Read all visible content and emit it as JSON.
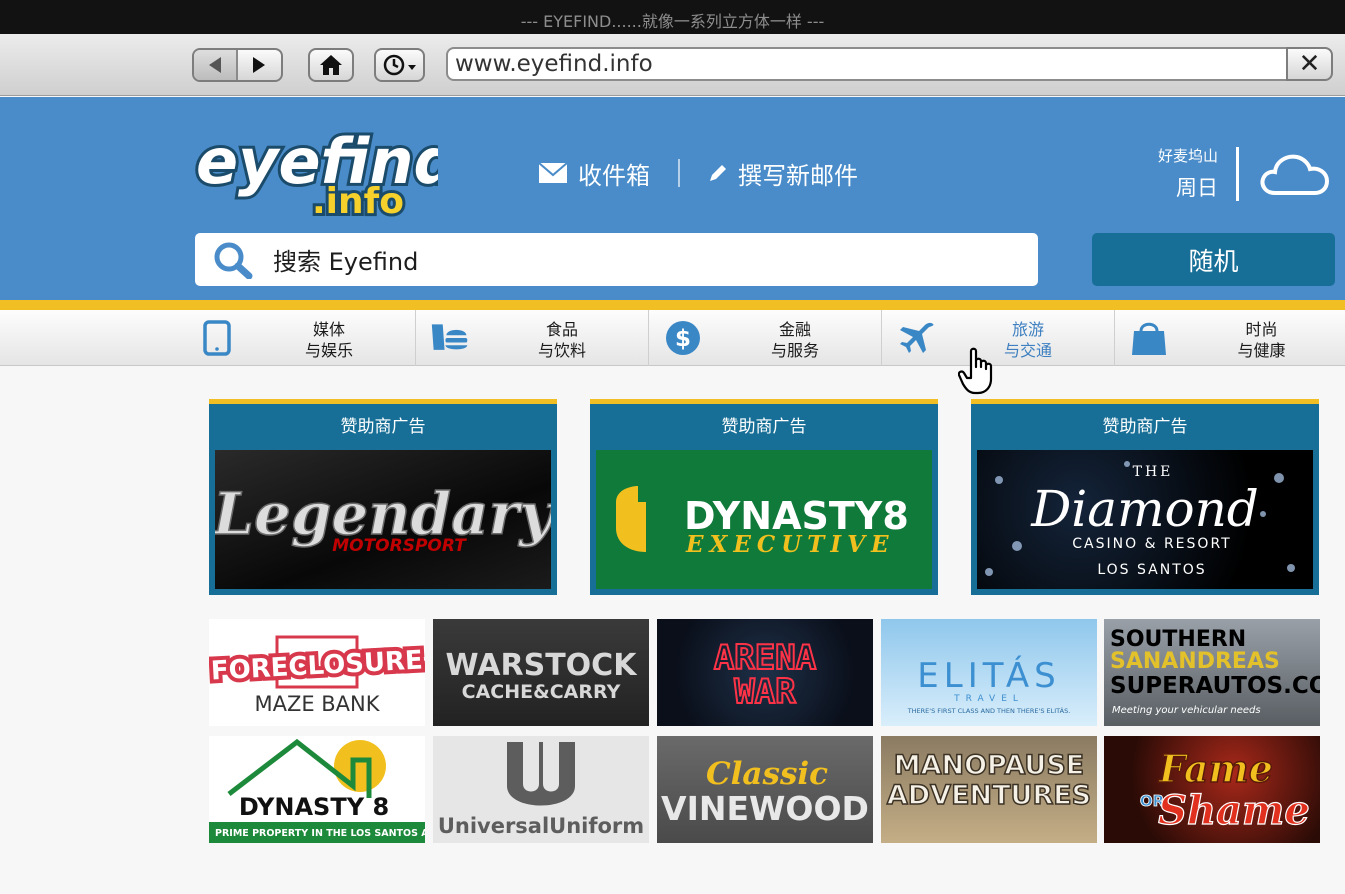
{
  "window": {
    "title": "--- EYEFIND......就像一系列立方体一样 ---"
  },
  "browser": {
    "url": "www.eyefind.info"
  },
  "header": {
    "logo_top": "eyefind",
    "logo_bottom": ".info",
    "inbox_label": "收件箱",
    "compose_label": "撰写新邮件",
    "weather_location": "好麦坞山",
    "weather_day": "周日",
    "search_label": "搜索 Eyefind",
    "random_label": "随机"
  },
  "categories": [
    {
      "line1": "媒体",
      "line2": "与娱乐",
      "icon": "tablet-icon"
    },
    {
      "line1": "食品",
      "line2": "与饮料",
      "icon": "food-icon"
    },
    {
      "line1": "金融",
      "line2": "与服务",
      "icon": "dollar-icon"
    },
    {
      "line1": "旅游",
      "line2": "与交通",
      "icon": "airplane-icon"
    },
    {
      "line1": "时尚",
      "line2": "与健康",
      "icon": "shopping-bag-icon"
    }
  ],
  "sponsors": [
    {
      "title": "赞助商广告",
      "main": "Legendary",
      "sub": "MOTORSPORT"
    },
    {
      "title": "赞助商广告",
      "main": "DYNASTY8",
      "sub": "EXECUTIVE"
    },
    {
      "title": "赞助商广告",
      "top": "THE",
      "main": "Diamond",
      "sub": "CASINO & RESORT",
      "sub2": "LOS SANTOS"
    }
  ],
  "tiles": [
    {
      "main": "FORECLOSURE",
      "sub": "MAZE BANK"
    },
    {
      "main": "WARSTOCK",
      "sub": "CACHE&CARRY"
    },
    {
      "main": "ARENA",
      "sub": "WAR"
    },
    {
      "main": "ELITÁS",
      "sub": "TRAVEL",
      "tag": "THERE'S FIRST CLASS AND THEN THERE'S ELITÁS."
    },
    {
      "line1": "SOUTHERN",
      "line2": "SANANDREAS",
      "line3": "SUPERAUTOS.COM",
      "tag": "Meeting your vehicular needs"
    },
    {
      "main": "DYNASTY 8",
      "sub": "PRIME PROPERTY IN THE LOS SANTOS AREA"
    },
    {
      "main": "UniversalUniform"
    },
    {
      "main": "Classic",
      "sub": "VINEWOOD"
    },
    {
      "main": "MANOPAUSE",
      "sub": "ADVENTURES"
    },
    {
      "main": "Fame",
      "mid": "OR",
      "sub": "Shame"
    }
  ]
}
